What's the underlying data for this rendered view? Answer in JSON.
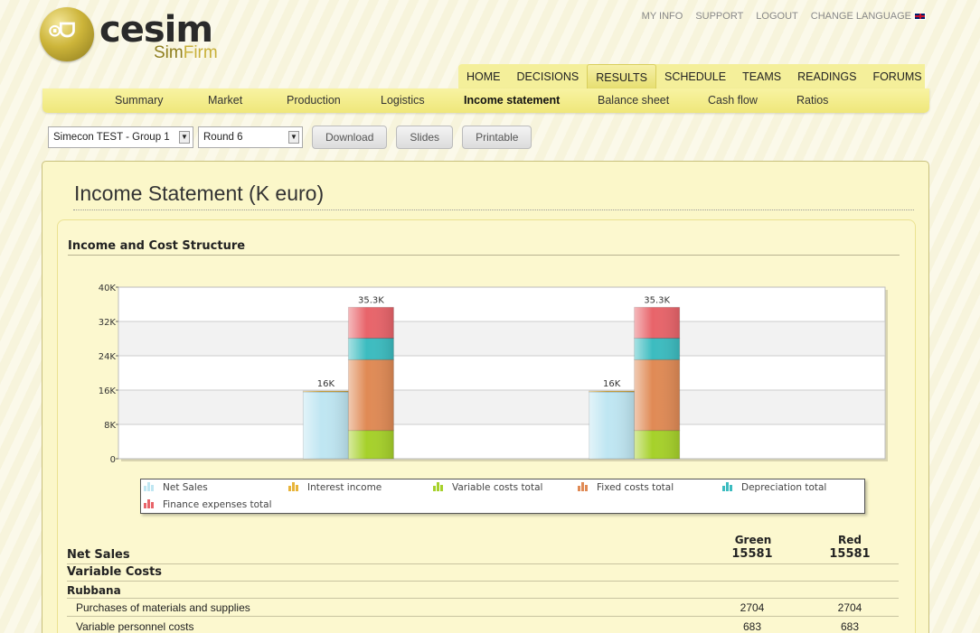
{
  "brand": {
    "name": "cesim",
    "product_a": "Sim",
    "product_b": "Firm",
    "emblem": "globe-emblem",
    "glyph": "⊙ᗜ"
  },
  "top_links": [
    "MY INFO",
    "SUPPORT",
    "LOGOUT",
    "CHANGE LANGUAGE"
  ],
  "main_nav": {
    "items": [
      "HOME",
      "DECISIONS",
      "RESULTS",
      "SCHEDULE",
      "TEAMS",
      "READINGS",
      "FORUMS"
    ],
    "active": "RESULTS"
  },
  "sub_nav": {
    "items": [
      "Summary",
      "Market",
      "Production",
      "Logistics",
      "Income statement",
      "Balance sheet",
      "Cash flow",
      "Ratios"
    ],
    "active": "Income statement"
  },
  "toolbar": {
    "group_select": "Simecon TEST - Group 1",
    "round_select": "Round 6",
    "download": "Download",
    "slides": "Slides",
    "printable": "Printable"
  },
  "page_title": "Income Statement (K euro)",
  "section_title": "Income and Cost Structure",
  "chart_data": {
    "type": "bar",
    "stacked": true,
    "groups": [
      "Green",
      "Red"
    ],
    "y_ticks": [
      "0",
      "8K",
      "16K",
      "24K",
      "32K",
      "40K"
    ],
    "ylim": [
      0,
      40000
    ],
    "grid": true,
    "legend_position": "bottom",
    "series": [
      {
        "name": "Net Sales",
        "stack": "income",
        "values": [
          15581,
          15581
        ],
        "color": "#bfe6f2"
      },
      {
        "name": "Interest income",
        "stack": "income",
        "values": [
          200,
          200
        ],
        "color": "#e8b43a"
      },
      {
        "name": "Variable costs total",
        "stack": "costs",
        "values": [
          6600,
          6600
        ],
        "color": "#a6d12a"
      },
      {
        "name": "Fixed costs total",
        "stack": "costs",
        "values": [
          16500,
          16500
        ],
        "color": "#e08a55"
      },
      {
        "name": "Depreciation total",
        "stack": "costs",
        "values": [
          5000,
          5000
        ],
        "color": "#3cbcc0"
      },
      {
        "name": "Finance expenses total",
        "stack": "costs",
        "values": [
          7200,
          7200
        ],
        "color": "#e8646a"
      }
    ],
    "labels": {
      "income": [
        "16K",
        "16K"
      ],
      "costs": [
        "35.3K",
        "35.3K"
      ]
    }
  },
  "table": {
    "columns": [
      "Green",
      "Red"
    ],
    "net_sales": {
      "label": "Net Sales",
      "values": [
        "15581",
        "15581"
      ]
    },
    "variable_costs": {
      "label": "Variable Costs"
    },
    "region": {
      "label": "Rubbana"
    },
    "rows": [
      {
        "label": "Purchases of materials and supplies",
        "values": [
          "2704",
          "2704"
        ]
      },
      {
        "label": "Variable personnel costs",
        "values": [
          "683",
          "683"
        ]
      }
    ]
  }
}
